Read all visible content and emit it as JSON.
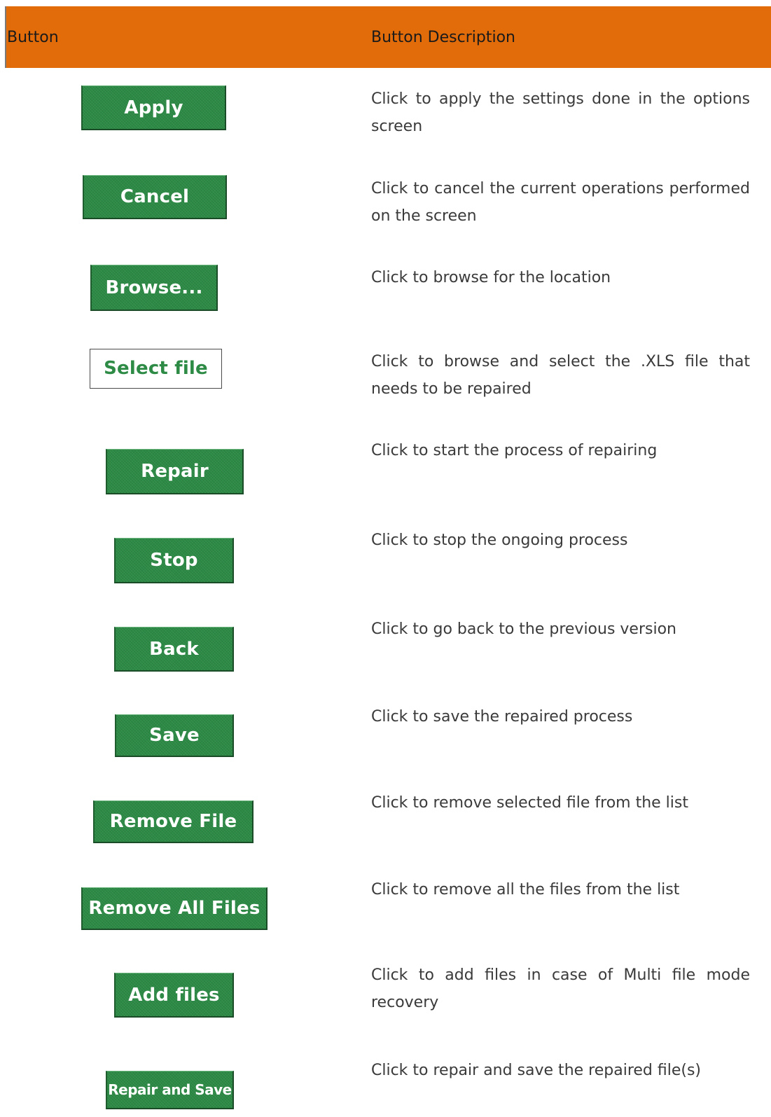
{
  "header": {
    "col_button": "Button",
    "col_description": "Button Description",
    "bg_color": "#e36c0a"
  },
  "rows": [
    {
      "label": "Apply",
      "description": "Click to apply the settings done in the options screen"
    },
    {
      "label": "Cancel",
      "description": "Click to cancel the current operations performed on the screen"
    },
    {
      "label": "Browse...",
      "description": "Click to browse for the location"
    },
    {
      "label": "Select file",
      "description": "Click to browse and select the .XLS file that needs to be repaired"
    },
    {
      "label": "Repair",
      "description": "Click to start the process of repairing"
    },
    {
      "label": "Stop",
      "description": "Click to stop the ongoing process"
    },
    {
      "label": "Back",
      "description": "Click to go back to the previous version"
    },
    {
      "label": "Save",
      "description": "Click to save the repaired process"
    },
    {
      "label": "Remove File",
      "description": "Click to remove selected file from the list"
    },
    {
      "label": "Remove All Files",
      "description": "Click to remove all the files from the list"
    },
    {
      "label": "Add files",
      "description": "Click to add files in case of Multi file mode recovery"
    },
    {
      "label": "Repair and Save",
      "description": "Click to repair and save the repaired file(s)"
    }
  ],
  "colors": {
    "button_green": "#2c8a45",
    "outline_text_green": "#2e8b46"
  }
}
